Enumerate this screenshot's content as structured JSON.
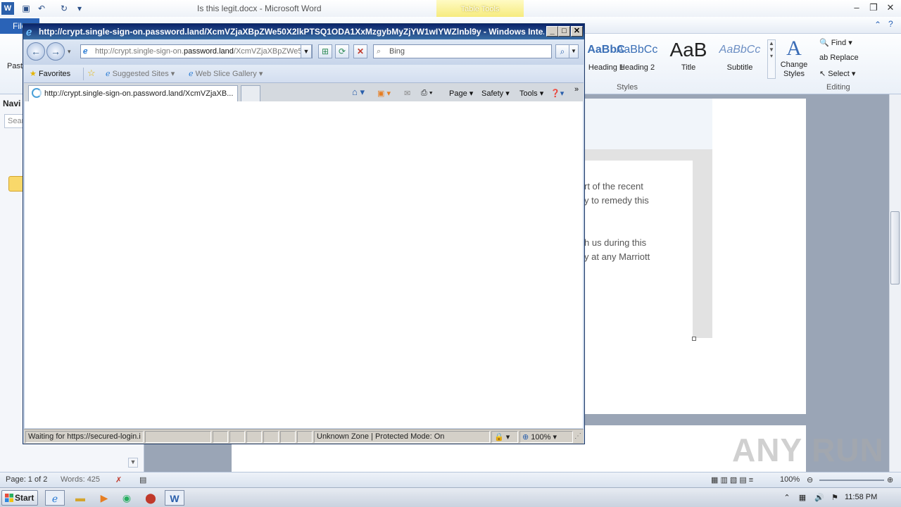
{
  "word": {
    "title": "Is this legit.docx - Microsoft Word",
    "table_tools": "Table Tools",
    "file_tab": "File",
    "paste": "Paste",
    "styles": [
      {
        "sample": "AaBbC",
        "label": "Heading 1"
      },
      {
        "sample": "AaBbCc",
        "label": "Heading 2"
      },
      {
        "sample": "AaB",
        "label": "Title"
      },
      {
        "sample": "AaBbCc",
        "label": "Subtitle"
      }
    ],
    "change_styles": "Change Styles",
    "styles_group": "Styles",
    "editing": {
      "find": "Find",
      "replace": "Replace",
      "select": "Select",
      "group": "Editing"
    },
    "nav_pane": {
      "title": "Navi",
      "search": "Sear"
    },
    "doc_lines": [
      "rt of the recent",
      "y to remedy this",
      "h us during this",
      "y at any Marriott"
    ],
    "status": {
      "page": "Page: 1 of 2",
      "words": "Words: 425",
      "zoom": "100%"
    }
  },
  "ie": {
    "title": "http://crypt.single-sign-on.password.land/XcmVZjaXBpZWe50X2lkPTSQ1ODA1XxMzgybMyZjYW1wIYWZlnbl9y - Windows Inte...",
    "address_prefix": "http://crypt.single-sign-on.",
    "address_domain": "password.land",
    "address_suffix": "/XcmVZjaXBpZWe5",
    "search_placeholder": "Bing",
    "favorites": "Favorites",
    "suggested_sites": "Suggested Sites",
    "web_slice": "Web Slice Gallery",
    "tab_title": "http://crypt.single-sign-on.password.land/XcmVZjaXB...",
    "commands": {
      "page": "Page",
      "safety": "Safety",
      "tools": "Tools"
    },
    "status_text": "Waiting for https://secured-login.i",
    "zone": "Unknown Zone | Protected Mode: On",
    "zoom": "100%"
  },
  "taskbar": {
    "start": "Start",
    "clock": "11:58 PM"
  },
  "watermark": "ANY RUN"
}
